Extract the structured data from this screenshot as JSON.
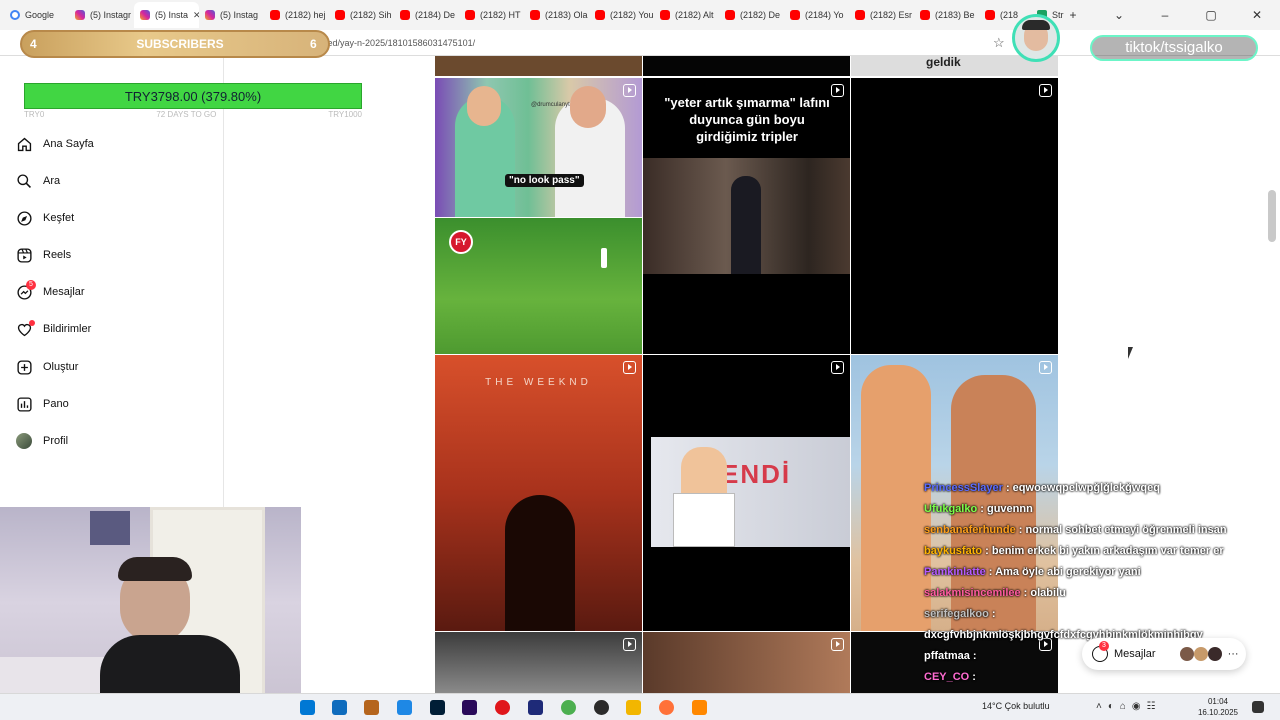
{
  "browser": {
    "tabs": [
      {
        "label": "Google",
        "icon": "google"
      },
      {
        "label": "(5) Instagr",
        "icon": "instagram"
      },
      {
        "label": "(5) Insta",
        "icon": "instagram",
        "active": true
      },
      {
        "label": "(5) Instag",
        "icon": "instagram"
      },
      {
        "label": "(2182) hej",
        "icon": "youtube"
      },
      {
        "label": "(2182) Sih",
        "icon": "youtube"
      },
      {
        "label": "(2184) De",
        "icon": "youtube"
      },
      {
        "label": "(2182) HT",
        "icon": "youtube"
      },
      {
        "label": "(2183) Ola",
        "icon": "youtube"
      },
      {
        "label": "(2182) You",
        "icon": "youtube"
      },
      {
        "label": "(2182) Alt",
        "icon": "youtube"
      },
      {
        "label": "(2182) De",
        "icon": "youtube"
      },
      {
        "label": "(2184) Yo",
        "icon": "youtube"
      },
      {
        "label": "(2182) Esr",
        "icon": "youtube"
      },
      {
        "label": "(2183) Be",
        "icon": "youtube"
      },
      {
        "label": "(218",
        "icon": "youtube"
      },
      {
        "label": "Str",
        "icon": "sheet"
      }
    ],
    "url": "www.instagram.com/ta  er/saved/yay-n-2025/18101586031475101/"
  },
  "overlay": {
    "subs_count": "4",
    "subs_label": "SUBSCRIBERS",
    "subs_right": "6",
    "goal_amount": "TRY3798.00 (379.80%)",
    "goal_left": "TRY0",
    "goal_mid": "72 DAYS TO GO",
    "goal_right": "TRY1000",
    "tiktok_handle": "tiktok/tssigalko"
  },
  "sidebar": {
    "items": [
      {
        "label": "Ana Sayfa",
        "icon": "home-icon"
      },
      {
        "label": "Ara",
        "icon": "search-icon"
      },
      {
        "label": "Keşfet",
        "icon": "compass-icon"
      },
      {
        "label": "Reels",
        "icon": "reels-icon"
      },
      {
        "label": "Mesajlar",
        "icon": "messenger-icon",
        "badge": "5"
      },
      {
        "label": "Bildirimler",
        "icon": "heart-icon",
        "dot": true
      },
      {
        "label": "Oluştur",
        "icon": "plus-square-icon"
      },
      {
        "label": "Pano",
        "icon": "dashboard-icon"
      },
      {
        "label": "Profil",
        "icon": "avatar"
      }
    ]
  },
  "grid": {
    "top_caption": "geldik",
    "c1_caption": "\"no look pass\"",
    "c1_tag": "@drumculanyt",
    "c1_badge": "FY",
    "c2_text": "\"yeter artık şımarma\" lafını duyunca gün boyu girdiğimiz tripler",
    "c4_text": "THE WEEKND",
    "c5_text": "ENDİ"
  },
  "chat": {
    "lines": [
      {
        "user": "PrincessSlayer",
        "text": "eqwoewqpelwpğlğlekğwqeq",
        "color": "#5a6cff"
      },
      {
        "user": "Ufukgalko",
        "text": "guvennn",
        "color": "#7cff4a"
      },
      {
        "user": "senbanaferhunde",
        "text": "normal sohbet etmeyi öğrenmeli insan",
        "color": "#ff9f1a"
      },
      {
        "user": "baykusfato",
        "text": "benim erkek bi yakın arkadaşım var temer er",
        "color": "#ffb400"
      },
      {
        "user": "Pamkinlatte",
        "text": "Ama öyle abi gerekiyor yani",
        "color": "#b45aff"
      },
      {
        "user": "salakmisincemilee",
        "text": "olabilu",
        "color": "#ff5aa0"
      },
      {
        "user": "serifegalkoo",
        "text": "",
        "color": "#c0c0c0"
      },
      {
        "user": "",
        "text": "dxcgfvhbjnkmlöşkjbhgvfcfdxfcgvhbjnkmlökmjnhjbgv",
        "color": "#fff"
      },
      {
        "user": "pffatmaa",
        "text": "",
        "color": "#fff"
      },
      {
        "user": "CEY_CO",
        "text": "",
        "color": "#ff6bd1"
      }
    ]
  },
  "messages_bar": {
    "label": "Mesajlar",
    "badge": "3"
  },
  "taskbar": {
    "weather": "14°C  Çok bulutlu",
    "time": "01:04",
    "date": "16.10.2025"
  }
}
